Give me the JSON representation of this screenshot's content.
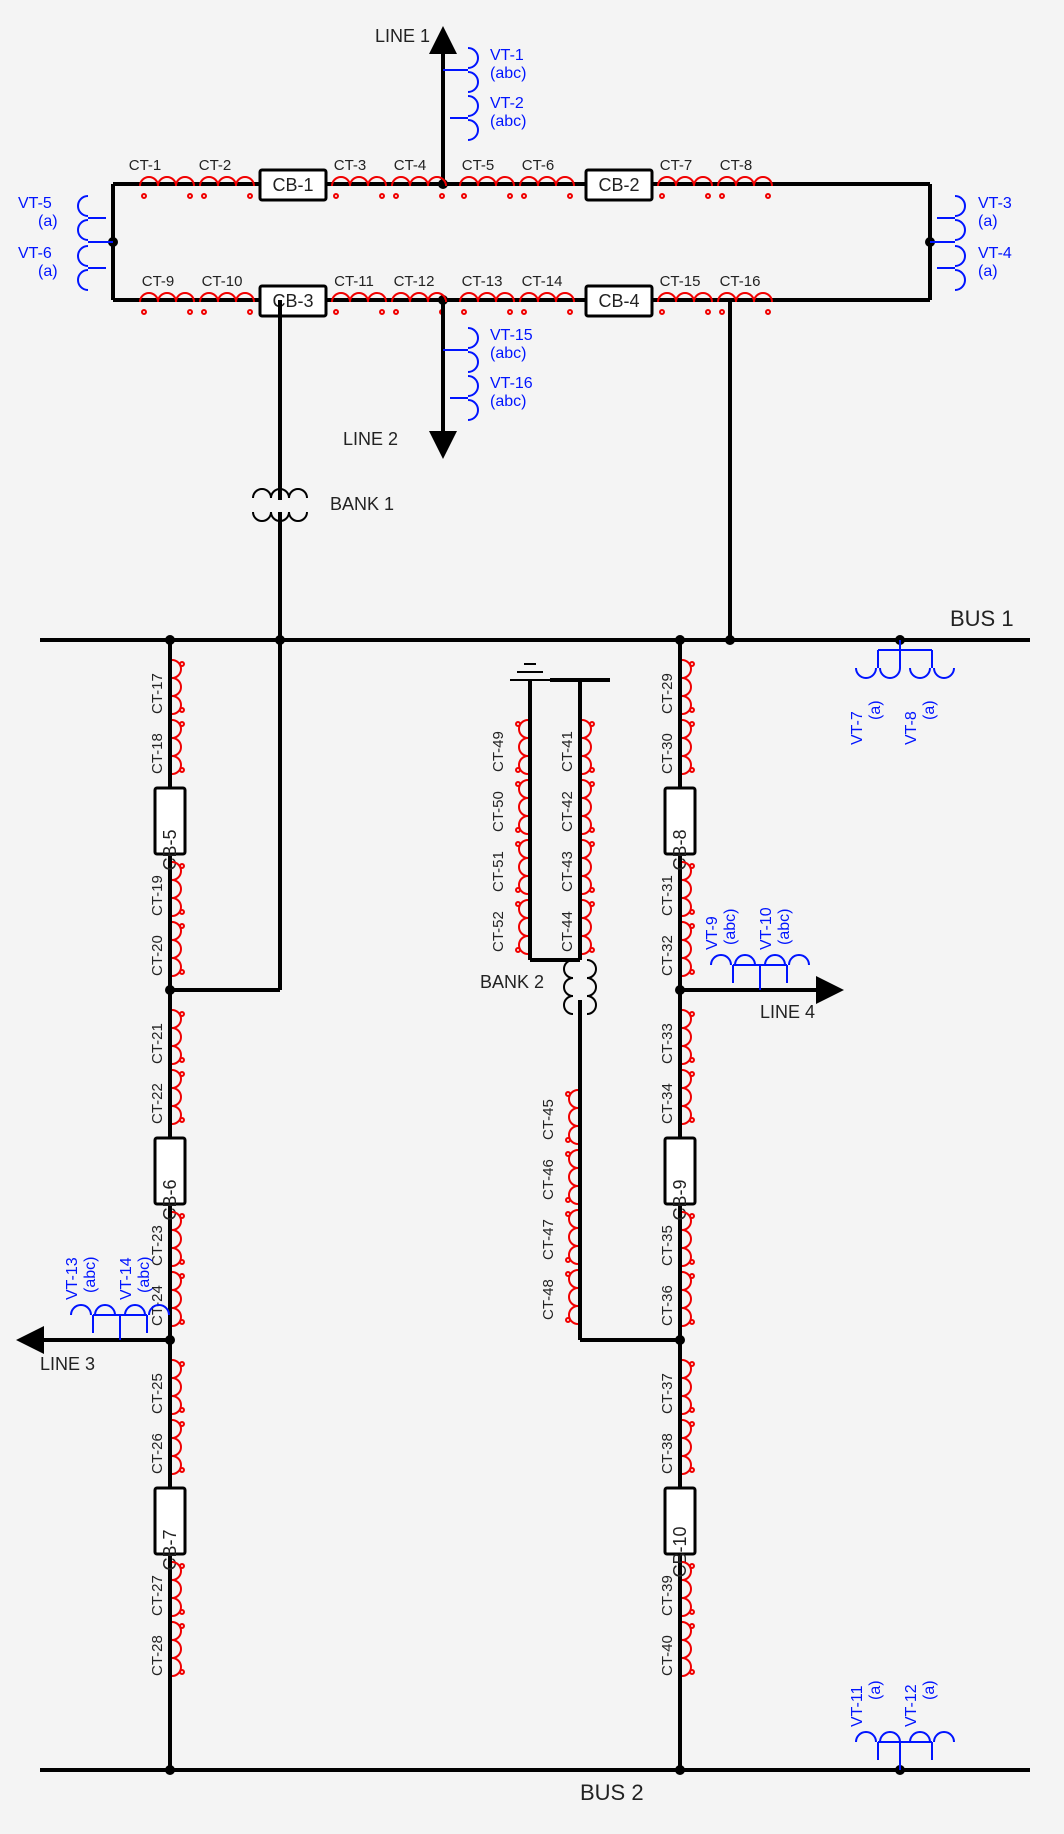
{
  "labels": {
    "line1": "LINE 1",
    "line2": "LINE 2",
    "line3": "LINE 3",
    "line4": "LINE 4",
    "bus1": "BUS 1",
    "bus2": "BUS 2",
    "bank1": "BANK 1",
    "bank2": "BANK 2"
  },
  "cb": {
    "cb1": "CB-1",
    "cb2": "CB-2",
    "cb3": "CB-3",
    "cb4": "CB-4",
    "cb5": "CB-5",
    "cb6": "CB-6",
    "cb7": "CB-7",
    "cb8": "CB-8",
    "cb9": "CB-9",
    "cb10": "CB-10"
  },
  "vt": {
    "vt1": {
      "n": "VT-1",
      "p": "(abc)"
    },
    "vt2": {
      "n": "VT-2",
      "p": "(abc)"
    },
    "vt3": {
      "n": "VT-3",
      "p": "(a)"
    },
    "vt4": {
      "n": "VT-4",
      "p": "(a)"
    },
    "vt5": {
      "n": "VT-5",
      "p": "(a)"
    },
    "vt6": {
      "n": "VT-6",
      "p": "(a)"
    },
    "vt7": {
      "n": "VT-7",
      "p": "(a)"
    },
    "vt8": {
      "n": "VT-8",
      "p": "(a)"
    },
    "vt9": {
      "n": "VT-9",
      "p": "(abc)"
    },
    "vt10": {
      "n": "VT-10",
      "p": "(abc)"
    },
    "vt11": {
      "n": "VT-11",
      "p": "(a)"
    },
    "vt12": {
      "n": "VT-12",
      "p": "(a)"
    },
    "vt13": {
      "n": "VT-13",
      "p": "(abc)"
    },
    "vt14": {
      "n": "VT-14",
      "p": "(abc)"
    },
    "vt15": {
      "n": "VT-15",
      "p": "(abc)"
    },
    "vt16": {
      "n": "VT-16",
      "p": "(abc)"
    }
  },
  "ct": {
    "ct1": "CT-1",
    "ct2": "CT-2",
    "ct3": "CT-3",
    "ct4": "CT-4",
    "ct5": "CT-5",
    "ct6": "CT-6",
    "ct7": "CT-7",
    "ct8": "CT-8",
    "ct9": "CT-9",
    "ct10": "CT-10",
    "ct11": "CT-11",
    "ct12": "CT-12",
    "ct13": "CT-13",
    "ct14": "CT-14",
    "ct15": "CT-15",
    "ct16": "CT-16",
    "ct17": "CT-17",
    "ct18": "CT-18",
    "ct19": "CT-19",
    "ct20": "CT-20",
    "ct21": "CT-21",
    "ct22": "CT-22",
    "ct23": "CT-23",
    "ct24": "CT-24",
    "ct25": "CT-25",
    "ct26": "CT-26",
    "ct27": "CT-27",
    "ct28": "CT-28",
    "ct29": "CT-29",
    "ct30": "CT-30",
    "ct31": "CT-31",
    "ct32": "CT-32",
    "ct33": "CT-33",
    "ct34": "CT-34",
    "ct35": "CT-35",
    "ct36": "CT-36",
    "ct37": "CT-37",
    "ct38": "CT-38",
    "ct39": "CT-39",
    "ct40": "CT-40",
    "ct41": "CT-41",
    "ct42": "CT-42",
    "ct43": "CT-43",
    "ct44": "CT-44",
    "ct45": "CT-45",
    "ct46": "CT-46",
    "ct47": "CT-47",
    "ct48": "CT-48",
    "ct49": "CT-49",
    "ct50": "CT-50",
    "ct51": "CT-51",
    "ct52": "CT-52"
  },
  "chart_data": {
    "type": "single-line-diagram",
    "lines": [
      "LINE 1",
      "LINE 2",
      "LINE 3",
      "LINE 4"
    ],
    "buses": [
      "BUS 1",
      "BUS 2"
    ],
    "banks": [
      "BANK 1",
      "BANK 2"
    ],
    "breakers": [
      {
        "id": "CB-1",
        "cts": [
          "CT-1",
          "CT-2",
          "CT-3",
          "CT-4"
        ]
      },
      {
        "id": "CB-2",
        "cts": [
          "CT-5",
          "CT-6",
          "CT-7",
          "CT-8"
        ]
      },
      {
        "id": "CB-3",
        "cts": [
          "CT-9",
          "CT-10",
          "CT-11",
          "CT-12"
        ]
      },
      {
        "id": "CB-4",
        "cts": [
          "CT-13",
          "CT-14",
          "CT-15",
          "CT-16"
        ]
      },
      {
        "id": "CB-5",
        "cts": [
          "CT-17",
          "CT-18",
          "CT-19",
          "CT-20"
        ]
      },
      {
        "id": "CB-6",
        "cts": [
          "CT-21",
          "CT-22",
          "CT-23",
          "CT-24"
        ]
      },
      {
        "id": "CB-7",
        "cts": [
          "CT-25",
          "CT-26",
          "CT-27",
          "CT-28"
        ]
      },
      {
        "id": "CB-8",
        "cts": [
          "CT-29",
          "CT-30",
          "CT-31",
          "CT-32"
        ]
      },
      {
        "id": "CB-9",
        "cts": [
          "CT-33",
          "CT-34",
          "CT-35",
          "CT-36"
        ]
      },
      {
        "id": "CB-10",
        "cts": [
          "CT-37",
          "CT-38",
          "CT-39",
          "CT-40"
        ]
      }
    ],
    "bank2_cts": {
      "secondary": [
        "CT-41",
        "CT-42",
        "CT-43",
        "CT-44"
      ],
      "neutral": [
        "CT-49",
        "CT-50",
        "CT-51",
        "CT-52"
      ],
      "primary": [
        "CT-45",
        "CT-46",
        "CT-47",
        "CT-48"
      ]
    },
    "vts": [
      {
        "id": "VT-1",
        "phases": "abc",
        "at": "LINE 1"
      },
      {
        "id": "VT-2",
        "phases": "abc",
        "at": "LINE 1"
      },
      {
        "id": "VT-3",
        "phases": "a",
        "at": "ring right"
      },
      {
        "id": "VT-4",
        "phases": "a",
        "at": "ring right"
      },
      {
        "id": "VT-5",
        "phases": "a",
        "at": "ring left"
      },
      {
        "id": "VT-6",
        "phases": "a",
        "at": "ring left"
      },
      {
        "id": "VT-7",
        "phases": "a",
        "at": "BUS 1"
      },
      {
        "id": "VT-8",
        "phases": "a",
        "at": "BUS 1"
      },
      {
        "id": "VT-9",
        "phases": "abc",
        "at": "LINE 4"
      },
      {
        "id": "VT-10",
        "phases": "abc",
        "at": "LINE 4"
      },
      {
        "id": "VT-11",
        "phases": "a",
        "at": "BUS 2"
      },
      {
        "id": "VT-12",
        "phases": "a",
        "at": "BUS 2"
      },
      {
        "id": "VT-13",
        "phases": "abc",
        "at": "LINE 3"
      },
      {
        "id": "VT-14",
        "phases": "abc",
        "at": "LINE 3"
      },
      {
        "id": "VT-15",
        "phases": "abc",
        "at": "LINE 2"
      },
      {
        "id": "VT-16",
        "phases": "abc",
        "at": "LINE 2"
      }
    ]
  }
}
